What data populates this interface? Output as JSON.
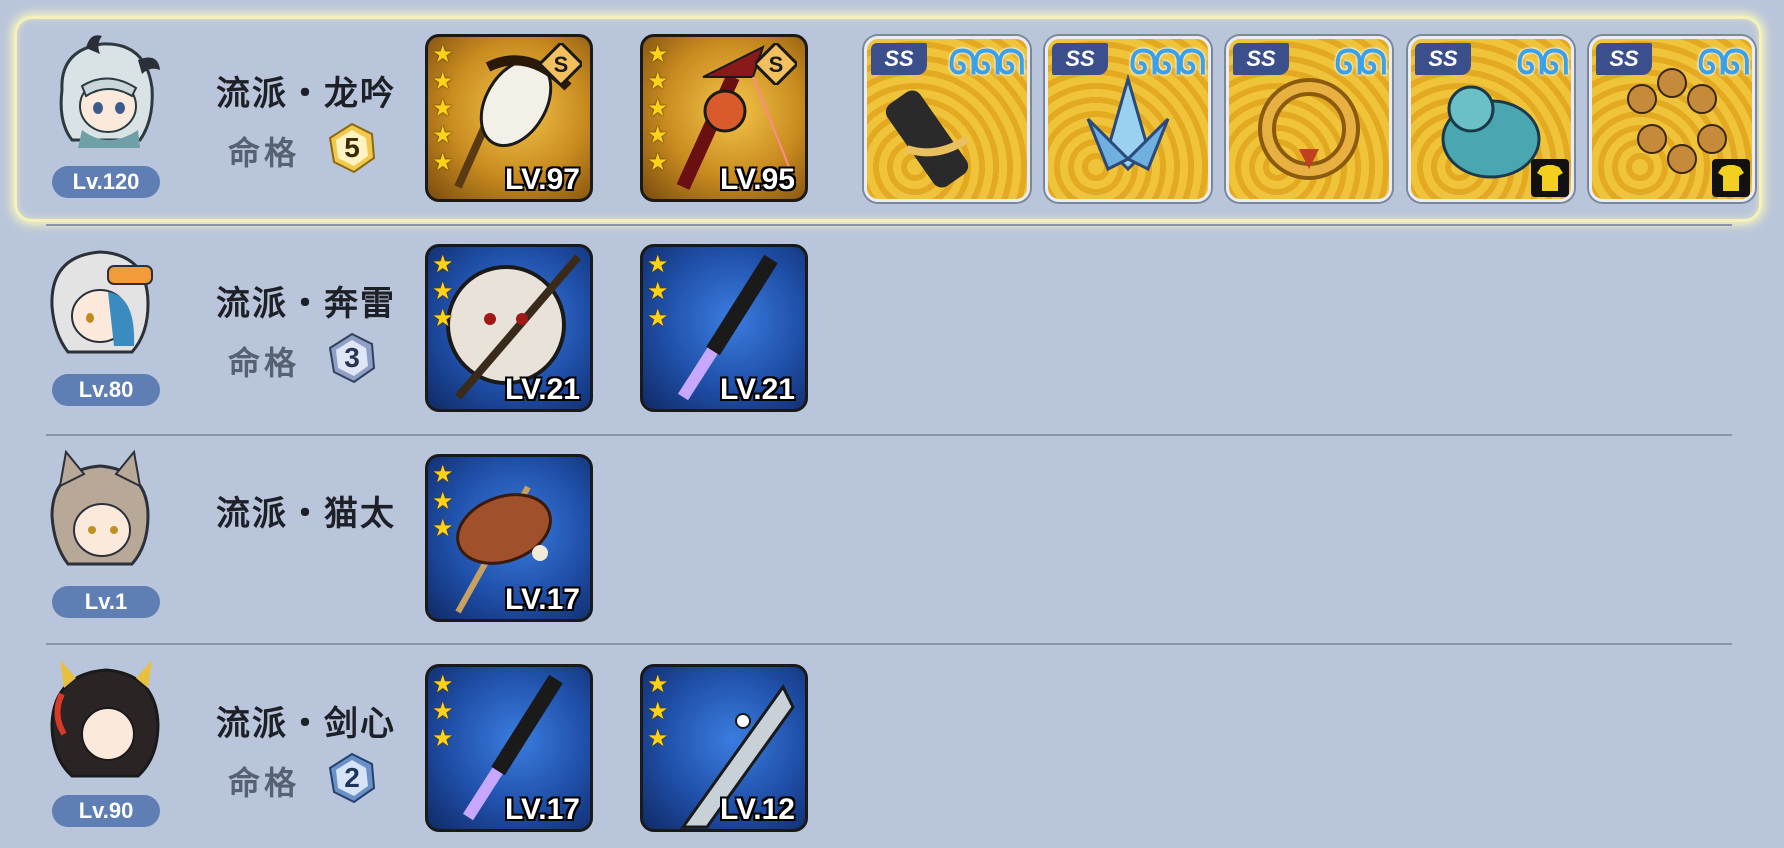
{
  "characters": [
    {
      "level": "Lv.120",
      "school": "流派・龙吟",
      "fate_label": "命格",
      "fate_value": "5",
      "weapons": [
        {
          "level": "LV.97",
          "stars": 5,
          "rarity": "gold",
          "icon": "brush-weapon-icon"
        },
        {
          "level": "LV.95",
          "stars": 5,
          "rarity": "gold",
          "icon": "red-fan-weapon-icon"
        }
      ],
      "items": [
        {
          "grade": "SS",
          "sprites": 3,
          "icon": "scroll-item-icon",
          "has_equip_tag": false
        },
        {
          "grade": "SS",
          "sprites": 3,
          "icon": "ice-lotus-item-icon",
          "has_equip_tag": false
        },
        {
          "grade": "SS",
          "sprites": 2,
          "icon": "golden-ring-item-icon",
          "has_equip_tag": false
        },
        {
          "grade": "SS",
          "sprites": 2,
          "icon": "jade-qilin-item-icon",
          "has_equip_tag": true
        },
        {
          "grade": "SS",
          "sprites": 2,
          "icon": "bead-bracelet-item-icon",
          "has_equip_tag": true
        }
      ]
    },
    {
      "level": "Lv.80",
      "school": "流派・奔雷",
      "fate_label": "命格",
      "fate_value": "3",
      "weapons": [
        {
          "level": "LV.21",
          "stars": 3,
          "rarity": "blue",
          "icon": "lantern-spear-weapon-icon"
        },
        {
          "level": "LV.21",
          "stars": 3,
          "rarity": "blue",
          "icon": "light-saber-weapon-icon"
        }
      ],
      "items": []
    },
    {
      "level": "Lv.1",
      "school": "流派・猫太",
      "fate_label": "",
      "fate_value": "",
      "weapons": [
        {
          "level": "LV.17",
          "stars": 3,
          "rarity": "blue",
          "icon": "meat-skewer-weapon-icon"
        }
      ],
      "items": []
    },
    {
      "level": "Lv.90",
      "school": "流派・剑心",
      "fate_label": "命格",
      "fate_value": "2",
      "weapons": [
        {
          "level": "LV.17",
          "stars": 3,
          "rarity": "blue",
          "icon": "light-saber-weapon-icon"
        },
        {
          "level": "LV.12",
          "stars": 3,
          "rarity": "blue",
          "icon": "fish-sword-weapon-icon"
        }
      ],
      "items": []
    }
  ],
  "colors": {
    "background": "#b9c5da",
    "level_pill": "#5f7eb4",
    "star": "#ffd21a",
    "highlight": "#f4f2b8"
  }
}
